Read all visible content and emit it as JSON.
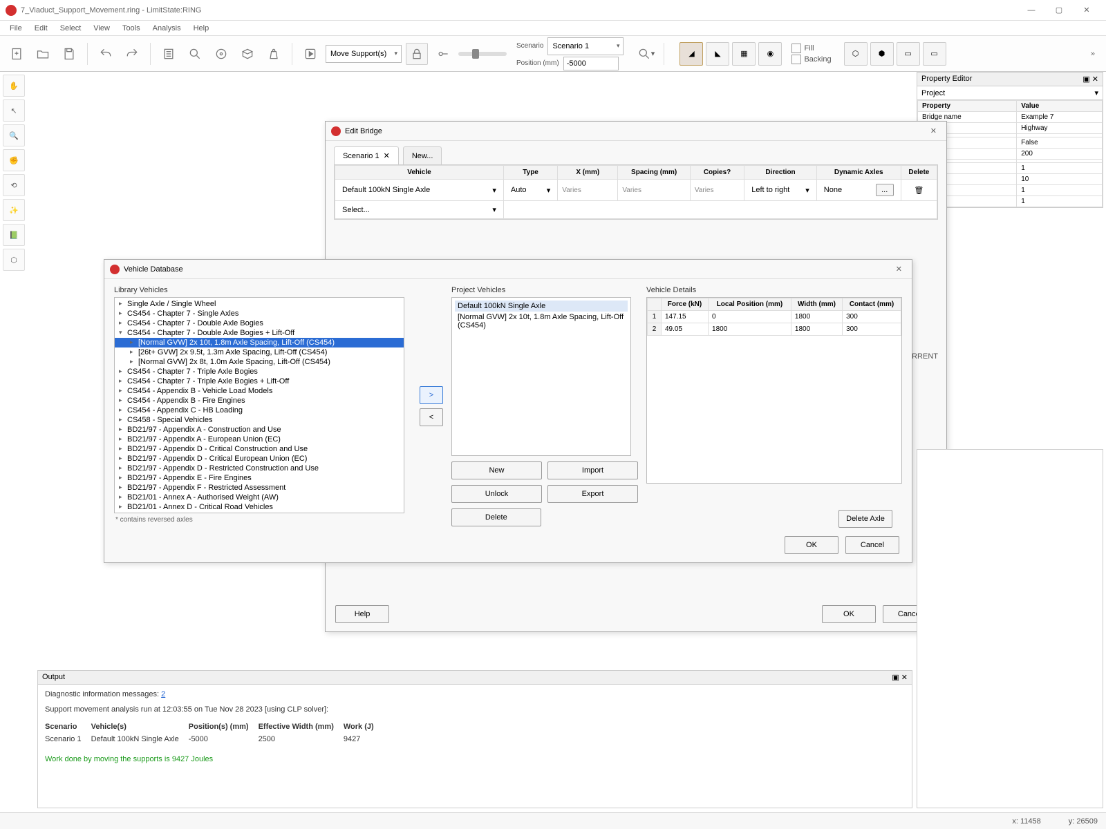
{
  "window": {
    "title": "7_Viaduct_Support_Movement.ring - LimitState:RING"
  },
  "menu": [
    "File",
    "Edit",
    "Select",
    "View",
    "Tools",
    "Analysis",
    "Help"
  ],
  "toolbar": {
    "move_supports": "Move Support(s)",
    "scenario_label": "Scenario",
    "scenario_value": "Scenario 1",
    "position_label": "Position (mm)",
    "position_value": "-5000",
    "fill": "Fill",
    "backing": "Backing"
  },
  "propeditor": {
    "title": "Property Editor",
    "selector": "Project",
    "headers": [
      "Property",
      "Value"
    ],
    "rows": [
      [
        "Bridge name",
        "Example 7"
      ],
      [
        "",
        "Highway"
      ],
      [
        "",
        ""
      ],
      [
        "",
        "False"
      ],
      [
        "",
        "200"
      ],
      [
        "",
        ""
      ],
      [
        "",
        "1"
      ],
      [
        "",
        "10"
      ],
      [
        "",
        "1"
      ],
      [
        "",
        "1"
      ]
    ]
  },
  "edit_bridge": {
    "title": "Edit Bridge",
    "tabs": {
      "scenario1": "Scenario 1",
      "new": "New..."
    },
    "columns": [
      "Vehicle",
      "Type",
      "X (mm)",
      "Spacing (mm)",
      "Copies?",
      "Direction",
      "Dynamic Axles",
      "Delete"
    ],
    "row1": {
      "vehicle": "Default 100kN Single Axle",
      "type": "Auto",
      "x": "Varies",
      "spacing": "Varies",
      "copies": "Varies",
      "direction": "Left to right",
      "dyn": "None",
      "dots": "..."
    },
    "row_select": "Select...",
    "lower_text": "ll but CURRENT",
    "help": "Help",
    "ok": "OK",
    "cancel": "Cancel"
  },
  "vehicle_db": {
    "title": "Vehicle Database",
    "library_label": "Library Vehicles",
    "project_label": "Project Vehicles",
    "details_label": "Vehicle Details",
    "tree": [
      {
        "t": "Single Axle / Single Wheel",
        "l": 1
      },
      {
        "t": "CS454 - Chapter 7 - Single Axles",
        "l": 1
      },
      {
        "t": "CS454 - Chapter 7 - Double Axle Bogies",
        "l": 1
      },
      {
        "t": "CS454 - Chapter 7 - Double Axle Bogies + Lift-Off",
        "l": 1,
        "exp": true
      },
      {
        "t": "[Normal GVW] 2x 10t, 1.8m Axle Spacing, Lift-Off (CS454)",
        "l": 2,
        "sel": true
      },
      {
        "t": "[26t+ GVW] 2x 9.5t, 1.3m Axle Spacing, Lift-Off (CS454)",
        "l": 2
      },
      {
        "t": "[Normal GVW] 2x 8t, 1.0m Axle Spacing, Lift-Off (CS454)",
        "l": 2
      },
      {
        "t": "CS454 - Chapter 7 - Triple Axle Bogies",
        "l": 1
      },
      {
        "t": "CS454 - Chapter 7 - Triple Axle Bogies + Lift-Off",
        "l": 1
      },
      {
        "t": "CS454 - Appendix B - Vehicle Load Models",
        "l": 1
      },
      {
        "t": "CS454 - Appendix B - Fire Engines",
        "l": 1
      },
      {
        "t": "CS454 - Appendix C - HB Loading",
        "l": 1
      },
      {
        "t": "CS458 - Special Vehicles",
        "l": 1
      },
      {
        "t": "BD21/97 - Appendix A - Construction and Use",
        "l": 1
      },
      {
        "t": "BD21/97 - Appendix A - European Union (EC)",
        "l": 1
      },
      {
        "t": "BD21/97 - Appendix D - Critical Construction and Use",
        "l": 1
      },
      {
        "t": "BD21/97 - Appendix D - Critical European Union (EC)",
        "l": 1
      },
      {
        "t": "BD21/97 - Appendix D - Restricted Construction and Use",
        "l": 1
      },
      {
        "t": "BD21/97 - Appendix E - Fire Engines",
        "l": 1
      },
      {
        "t": "BD21/97 - Appendix F - Restricted Assessment",
        "l": 1
      },
      {
        "t": "BD21/01 - Annex A - Authorised Weight (AW)",
        "l": 1
      },
      {
        "t": "BD21/01 - Annex D - Critical Road Vehicles",
        "l": 1
      }
    ],
    "note": "* contains reversed axles",
    "move_right": ">",
    "move_left": "<",
    "project_vehicles": [
      "Default 100kN Single Axle",
      "[Normal GVW] 2x 10t, 1.8m Axle Spacing, Lift-Off (CS454)"
    ],
    "proj_btns": {
      "new": "New",
      "import": "Import",
      "unlock": "Unlock",
      "export": "Export",
      "delete": "Delete"
    },
    "details_headers": [
      "",
      "Force (kN)",
      "Local Position (mm)",
      "Width (mm)",
      "Contact (mm)"
    ],
    "details_rows": [
      [
        "1",
        "147.15",
        "0",
        "1800",
        "300"
      ],
      [
        "2",
        "49.05",
        "1800",
        "1800",
        "300"
      ]
    ],
    "delete_axle": "Delete Axle",
    "ok": "OK",
    "cancel": "Cancel"
  },
  "output": {
    "title": "Output",
    "diag_label": "Diagnostic information messages: ",
    "diag_count": "2",
    "run_line": "Support movement analysis run at 12:03:55 on Tue Nov 28 2023 [using CLP solver]:",
    "headers": [
      "Scenario",
      "Vehicle(s)",
      "Position(s) (mm)",
      "Effective Width (mm)",
      "Work (J)"
    ],
    "row": [
      "Scenario 1",
      "Default 100kN Single Axle",
      "-5000",
      "2500",
      "9427"
    ],
    "result": "Work done by moving the supports is 9427 Joules"
  },
  "status": {
    "x_label": "x:",
    "x": "11458",
    "y_label": "y:",
    "y": "26509"
  }
}
